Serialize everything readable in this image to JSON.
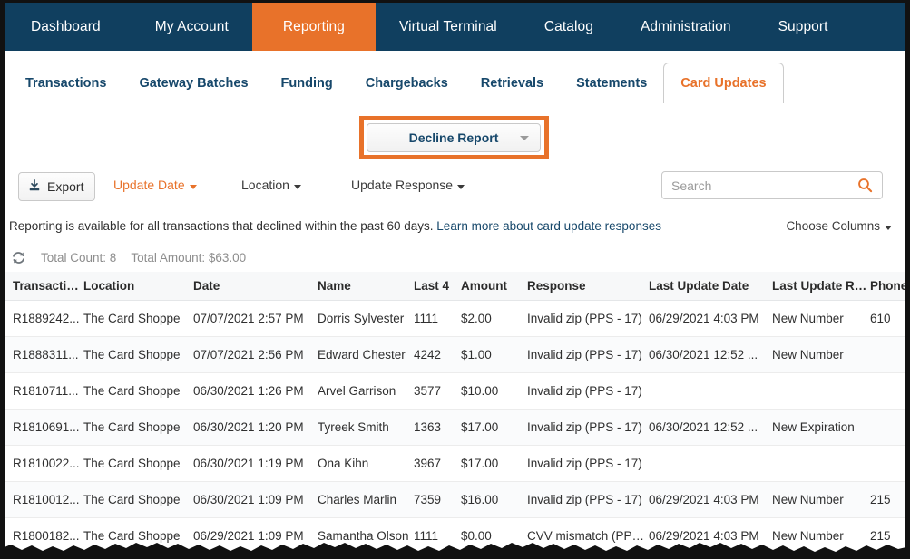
{
  "topnav": {
    "items": [
      {
        "label": "Dashboard",
        "active": false
      },
      {
        "label": "My Account",
        "active": false
      },
      {
        "label": "Reporting",
        "active": true
      },
      {
        "label": "Virtual Terminal",
        "active": false
      },
      {
        "label": "Catalog",
        "active": false
      },
      {
        "label": "Administration",
        "active": false
      },
      {
        "label": "Support",
        "active": false
      }
    ],
    "active_color": "#e8722a",
    "bar_color": "#103f5f"
  },
  "subtabs": {
    "items": [
      {
        "label": "Transactions",
        "active": false
      },
      {
        "label": "Gateway Batches",
        "active": false
      },
      {
        "label": "Funding",
        "active": false
      },
      {
        "label": "Chargebacks",
        "active": false
      },
      {
        "label": "Retrievals",
        "active": false
      },
      {
        "label": "Statements",
        "active": false
      },
      {
        "label": "Card Updates",
        "active": true
      }
    ]
  },
  "report_selector": {
    "value": "Decline Report",
    "caret": "chevron-down-icon",
    "highlight_color": "#e8722a"
  },
  "toolbar": {
    "export_label": "Export",
    "export_icon": "download-icon",
    "filters": [
      {
        "label": "Update Date",
        "style": "orange"
      },
      {
        "label": "Location",
        "style": "grey"
      },
      {
        "label": "Update Response",
        "style": "grey"
      }
    ],
    "search": {
      "placeholder": "Search",
      "value": "",
      "icon": "search-icon",
      "icon_color": "#e8722a"
    }
  },
  "info": {
    "text": "Reporting is available for all transactions that declined within the past 60 days.",
    "link_text": "Learn more about card update responses",
    "choose_columns_label": "Choose Columns"
  },
  "totals": {
    "refresh_icon": "refresh-icon",
    "count_label": "Total Count: 8",
    "amount_label": "Total Amount: $63.00"
  },
  "table": {
    "columns": [
      "Transaction #",
      "Location",
      "Date",
      "Name",
      "Last 4",
      "Amount",
      "Response",
      "Last Update Date",
      "Last Update Res...",
      "Phone"
    ],
    "rows": [
      {
        "txn": "R1889242...",
        "location": "The Card Shoppe",
        "date": "07/07/2021 2:57 PM",
        "name": "Dorris Sylvester",
        "last4": "1111",
        "amount": "$2.00",
        "response": "Invalid zip (PPS - 17)",
        "last_update_date": "06/29/2021 4:03 PM",
        "last_update_response": "New Number",
        "phone": "610"
      },
      {
        "txn": "R1888311...",
        "location": "The Card Shoppe",
        "date": "07/07/2021 2:56 PM",
        "name": "Edward Chester",
        "last4": "4242",
        "amount": "$1.00",
        "response": "Invalid zip (PPS - 17)",
        "last_update_date": "06/30/2021 12:52 ...",
        "last_update_response": "New Number",
        "phone": ""
      },
      {
        "txn": "R1810711...",
        "location": "The Card Shoppe",
        "date": "06/30/2021 1:26 PM",
        "name": "Arvel Garrison",
        "last4": "3577",
        "amount": "$10.00",
        "response": "Invalid zip (PPS - 17)",
        "last_update_date": "",
        "last_update_response": "",
        "phone": ""
      },
      {
        "txn": "R1810691...",
        "location": "The Card Shoppe",
        "date": "06/30/2021 1:20 PM",
        "name": "Tyreek Smith",
        "last4": "1363",
        "amount": "$17.00",
        "response": "Invalid zip (PPS - 17)",
        "last_update_date": "06/30/2021 12:52 ...",
        "last_update_response": "New Expiration",
        "phone": ""
      },
      {
        "txn": "R1810022...",
        "location": "The Card Shoppe",
        "date": "06/30/2021 1:19 PM",
        "name": "Ona Kihn",
        "last4": "3967",
        "amount": "$17.00",
        "response": "Invalid zip (PPS - 17)",
        "last_update_date": "",
        "last_update_response": "",
        "phone": ""
      },
      {
        "txn": "R1810012...",
        "location": "The Card Shoppe",
        "date": "06/30/2021 1:09 PM",
        "name": "Charles Marlin",
        "last4": "7359",
        "amount": "$16.00",
        "response": "Invalid zip (PPS - 17)",
        "last_update_date": "06/29/2021 4:03 PM",
        "last_update_response": "New Number",
        "phone": "215"
      },
      {
        "txn": "R1800182...",
        "location": "The Card Shoppe",
        "date": "06/29/2021 1:09 PM",
        "name": "Samantha Olson",
        "last4": "1111",
        "amount": "$0.00",
        "response": "CVV mismatch (PPS...",
        "last_update_date": "06/29/2021 4:03 PM",
        "last_update_response": "New Number",
        "phone": "215"
      }
    ]
  }
}
